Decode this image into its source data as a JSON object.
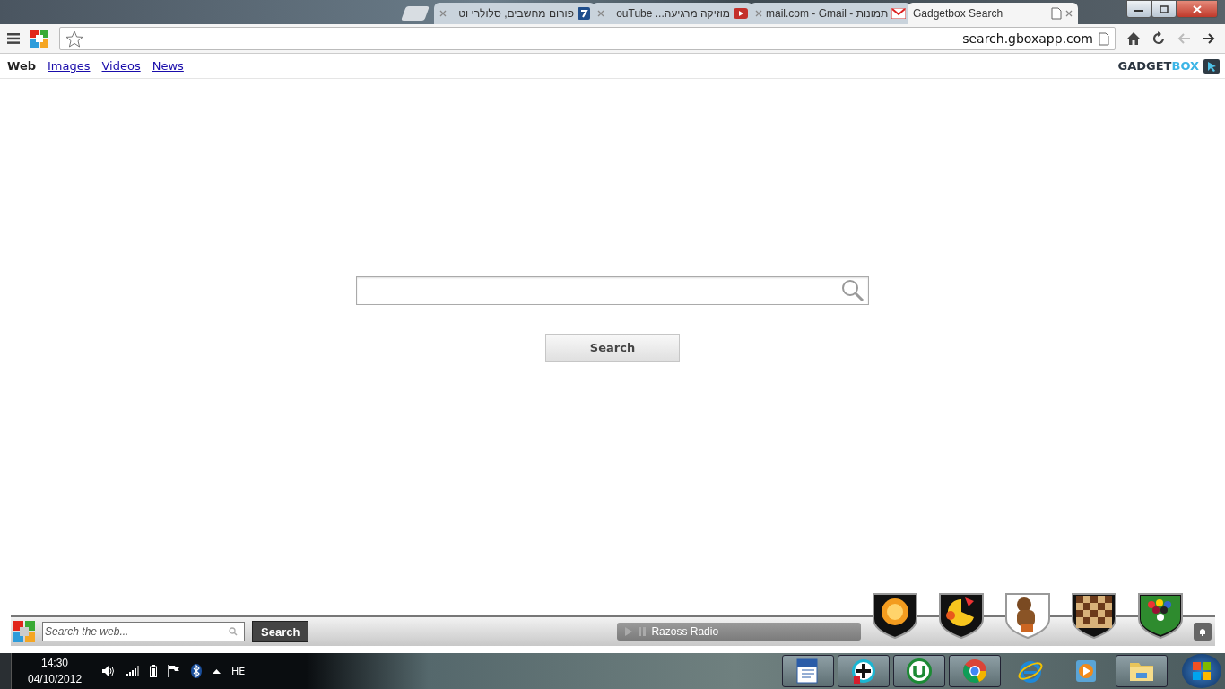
{
  "tabs": [
    {
      "kind": "forum",
      "title": "פורום מחשבים, סלולרי וט",
      "selected": false
    },
    {
      "kind": "video",
      "title": "ouTube ...מוזיקה מרגיעה",
      "selected": false
    },
    {
      "kind": "mail",
      "title": "mail.com - Gmail - תמונות",
      "selected": false
    },
    {
      "kind": "page",
      "title": "Gadgetbox Search",
      "selected": true
    }
  ],
  "address": "search.gboxapp.com",
  "nav": [
    {
      "label": "Web",
      "selected": true
    },
    {
      "label": "Images",
      "selected": false
    },
    {
      "label": "Videos",
      "selected": false
    },
    {
      "label": "News",
      "selected": false
    }
  ],
  "logo": [
    "GADGET",
    "BOX"
  ],
  "search": {
    "button": "Search"
  },
  "toolbar": {
    "placeholder": "Search the web...",
    "button": "Search",
    "radio": "Razoss Radio",
    "games": [
      {
        "kind": "ball"
      },
      {
        "kind": "chomper"
      },
      {
        "kind": "figure"
      },
      {
        "kind": "checkers"
      },
      {
        "kind": "pool"
      }
    ]
  },
  "taskbar": {
    "time": "14:30",
    "date": "04/10/2012",
    "language": "HE",
    "apps": [
      {
        "kind": "document",
        "running": true
      },
      {
        "kind": "plus",
        "running": true
      },
      {
        "kind": "torrent",
        "running": true
      },
      {
        "kind": "browser",
        "running": true
      },
      {
        "kind": "explorer-e",
        "running": false
      },
      {
        "kind": "media",
        "running": false
      },
      {
        "kind": "folder",
        "running": true
      }
    ]
  }
}
